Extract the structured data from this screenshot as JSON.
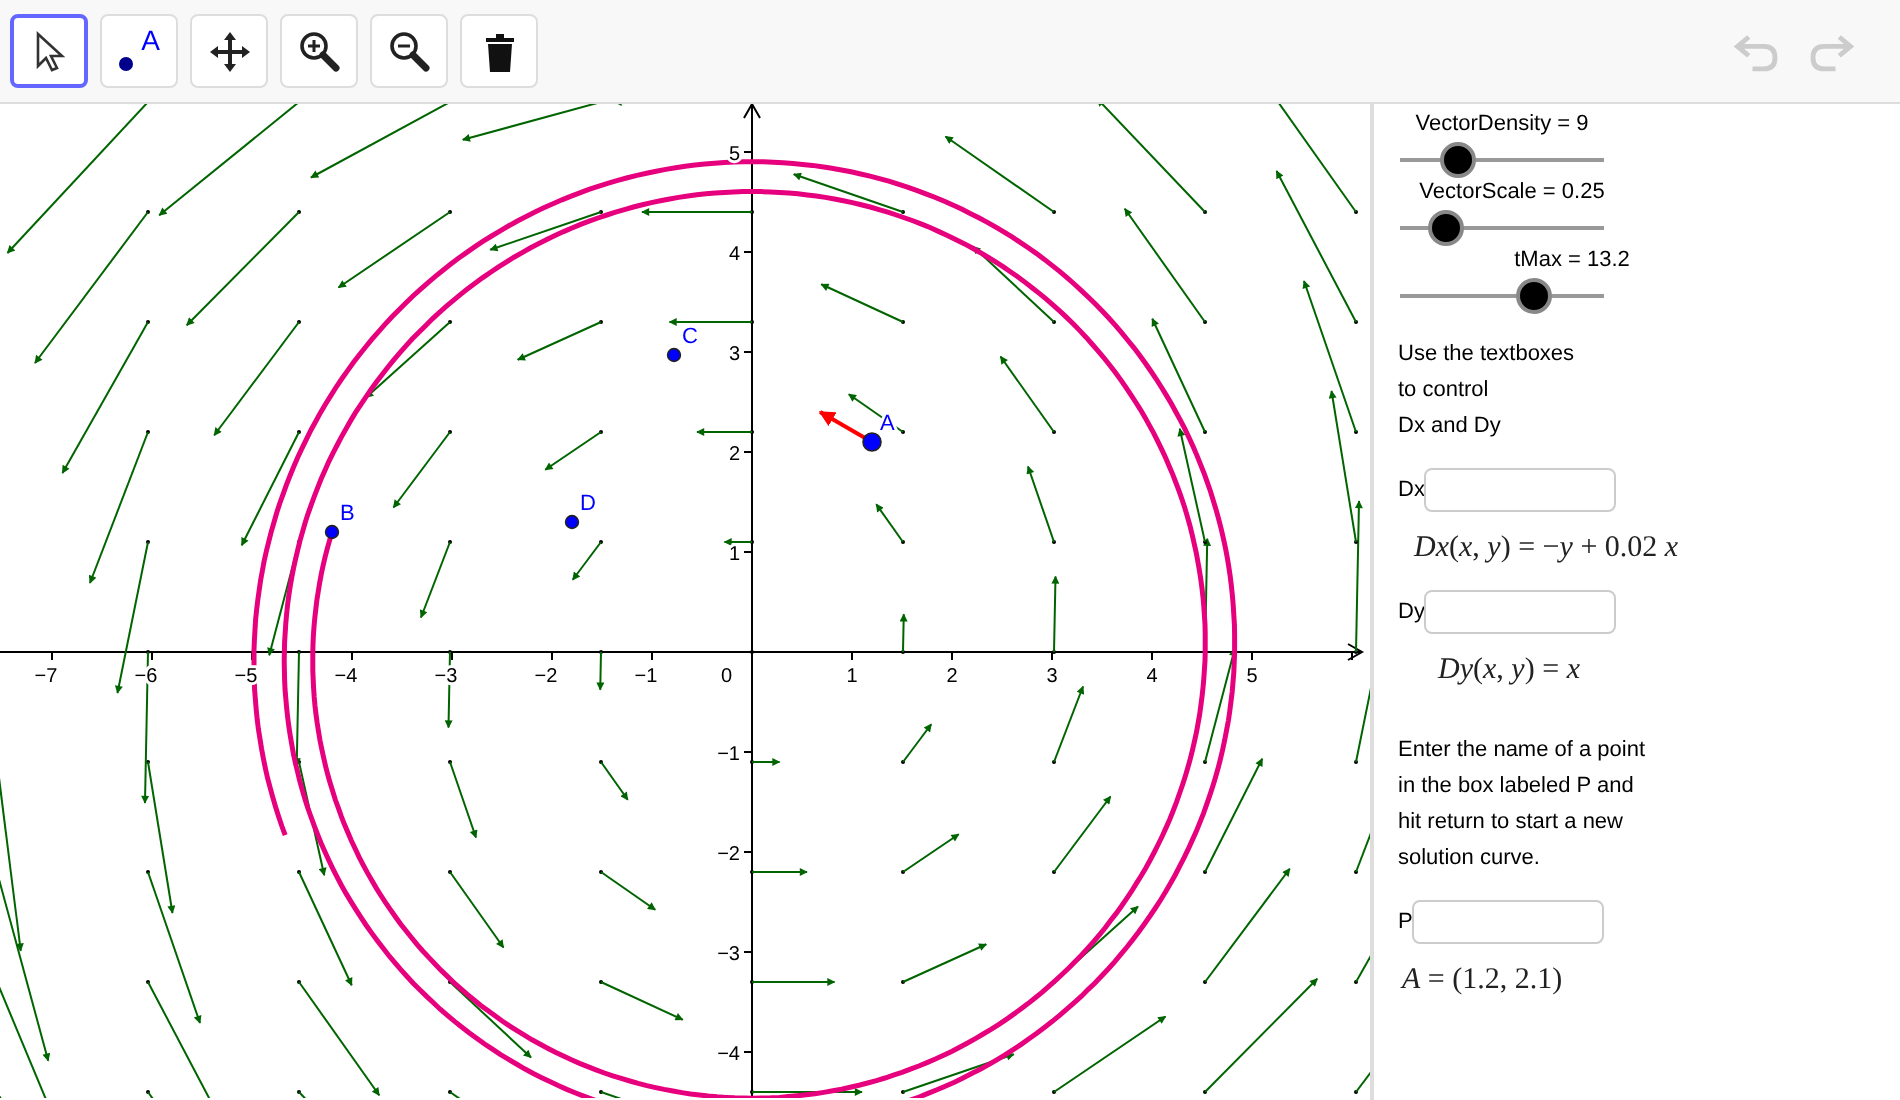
{
  "toolbar": {
    "tools": [
      {
        "kind": "select",
        "selected": true
      },
      {
        "kind": "point",
        "label": "A",
        "selected": false
      },
      {
        "kind": "move",
        "selected": false
      },
      {
        "kind": "zoom-in",
        "selected": false
      },
      {
        "kind": "zoom-out",
        "selected": false
      },
      {
        "kind": "delete",
        "selected": false
      }
    ],
    "undo": {
      "disabled": true
    },
    "redo": {
      "disabled": true
    }
  },
  "graph": {
    "x_labels": [
      "−7",
      "−6",
      "−5",
      "−4",
      "−3",
      "−2",
      "−1",
      "1",
      "2",
      "3",
      "4",
      "5"
    ],
    "y_labels": [
      "5",
      "4",
      "3",
      "2",
      "1",
      "−1",
      "−2",
      "−3",
      "−4"
    ],
    "origin_label": "0",
    "points": [
      {
        "label": "A",
        "selected": true
      },
      {
        "label": "B",
        "selected": false
      },
      {
        "label": "C",
        "selected": false
      },
      {
        "label": "D",
        "selected": false
      }
    ]
  },
  "panel": {
    "sliders": [
      {
        "label": "VectorDensity = 9",
        "level": 0.28
      },
      {
        "label": "VectorScale = 0.25",
        "level": 0.23
      },
      {
        "label": "tMax = 13.2",
        "level": 0.66
      }
    ],
    "intro": [
      "Use the textboxes",
      "to control",
      "Dx and Dy"
    ],
    "dx_field": {
      "label": "Dx"
    },
    "dx_formula": "*Dx*(*x*, *y*) = −*y* + 0.02 *x*",
    "dy_field": {
      "label": "Dy"
    },
    "dy_formula": "*Dy*(*x*, *y*) = *x*",
    "instructions": [
      "Enter the name of a point",
      "in the box labeled P and",
      "hit return to start a new",
      "solution curve."
    ],
    "p_field": {
      "label": "P"
    },
    "a_value": "*A* = (1.2, 2.1)"
  }
}
